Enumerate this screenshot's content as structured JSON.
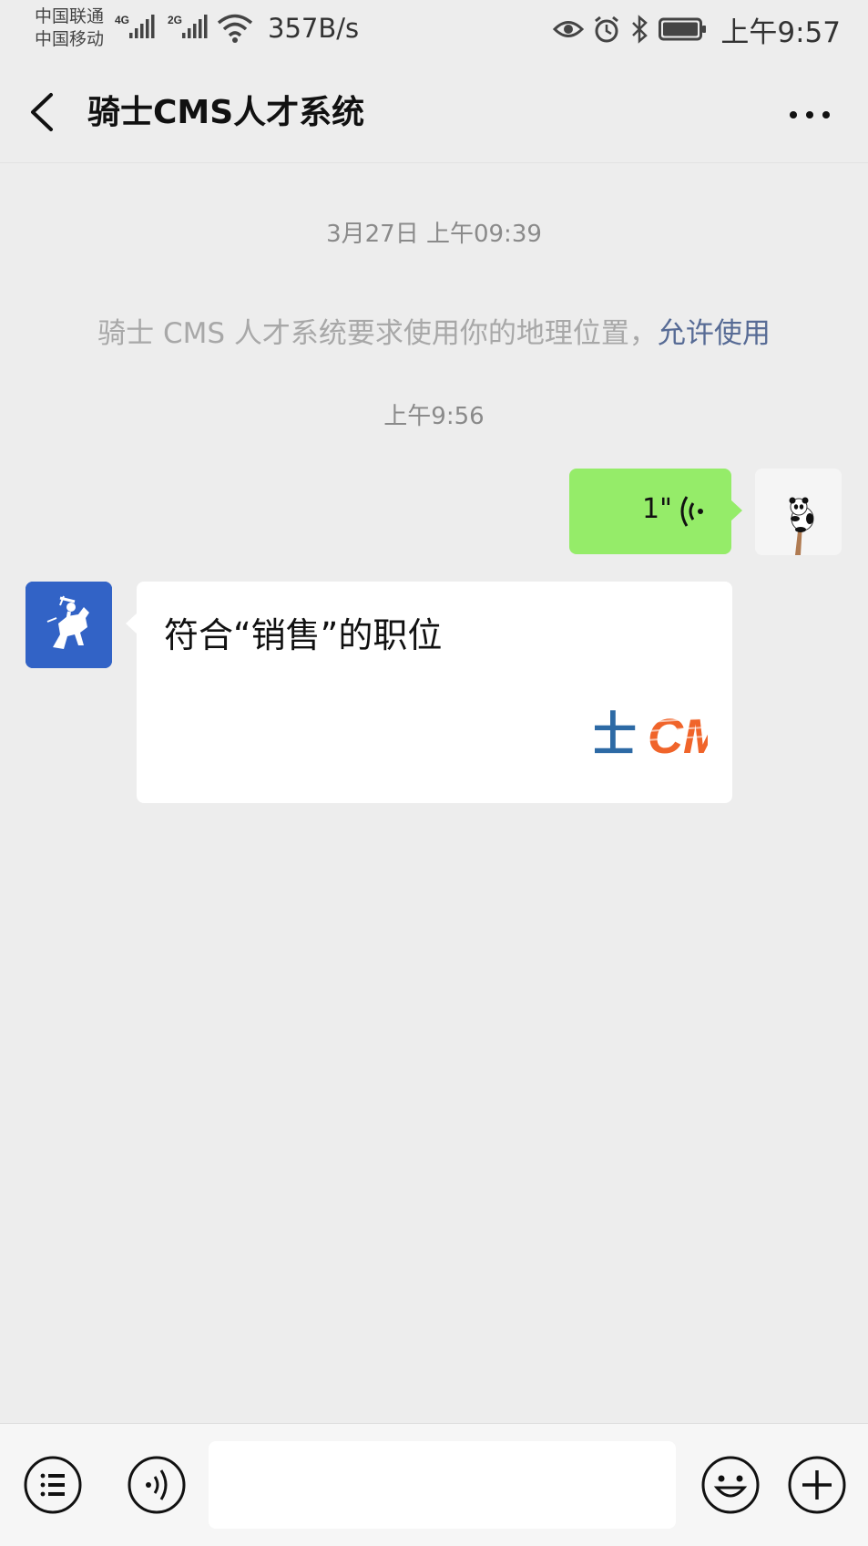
{
  "status_bar": {
    "carrier_1": "中国联通",
    "carrier_2": "中国移动",
    "network_1": "4G",
    "network_2": "2G",
    "net_speed": "357B/s",
    "time": "上午9:57",
    "icons": [
      "signal-icon",
      "wifi-icon",
      "eye-icon",
      "alarm-icon",
      "bluetooth-icon",
      "battery-icon"
    ]
  },
  "header": {
    "title": "骑士CMS人才系统",
    "back_icon": "chevron-left-icon",
    "more_icon": "ellipsis-icon"
  },
  "chat": {
    "timestamp_1": "3月27日 上午09:39",
    "system_message": "骑士 CMS 人才系统要求使用你的地理位置，",
    "system_link": "允许使用",
    "timestamp_2": "上午9:56",
    "voice_message": {
      "duration": "1\"",
      "icon": "voice-wave-icon"
    },
    "bot_card": {
      "title": "符合“销售”的职位",
      "logo_text": "士CM"
    }
  },
  "bottom_bar": {
    "input_value": "",
    "icons": [
      "menu-list-icon",
      "voice-icon",
      "emoji-icon",
      "plus-icon"
    ]
  },
  "colors": {
    "background": "#ededed",
    "voice_bubble": "#95ec69",
    "link": "#576b95",
    "bot_avatar": "#3263c6",
    "logo_blue": "#2d6aa5",
    "logo_orange": "#f0642a"
  }
}
